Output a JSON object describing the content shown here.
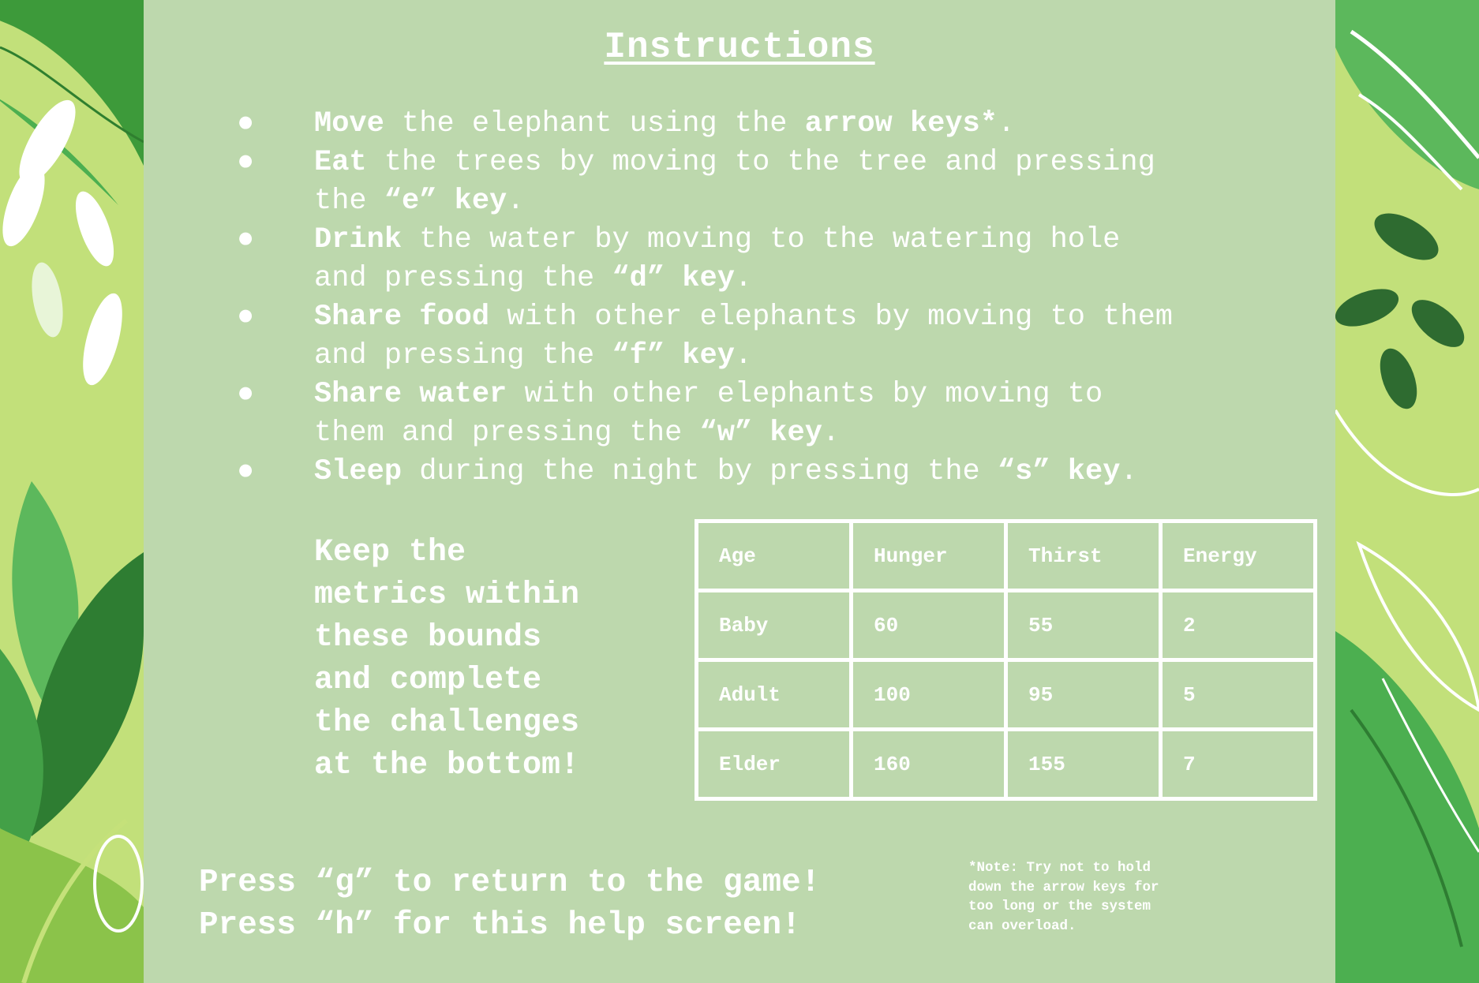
{
  "colors": {
    "panel": "#bdd8ad",
    "text": "#ffffff",
    "jungle_bg": "#c2e07a"
  },
  "title": "Instructions",
  "instructions": [
    {
      "bold": "Move",
      "rest": " the elephant using the ",
      "bold2": "arrow keys*",
      "tail": "."
    },
    {
      "bold": "Eat",
      "rest": " the trees by moving to the tree and pressing\nthe ",
      "bold2": "“e” key",
      "tail": "."
    },
    {
      "bold": "Drink",
      "rest": " the water by moving to the watering hole\nand pressing the ",
      "bold2": "“d” key",
      "tail": "."
    },
    {
      "bold": "Share food",
      "rest": " with other elephants by moving to them\nand pressing the ",
      "bold2": "“f” key",
      "tail": "."
    },
    {
      "bold": "Share water",
      "rest": " with other elephants by moving to\nthem and pressing the ",
      "bold2": "“w” key",
      "tail": "."
    },
    {
      "bold": "Sleep",
      "rest": " during the night by pressing the ",
      "bold2": "“s” key",
      "tail": "."
    }
  ],
  "bullet_glyph": "●",
  "keep_text": "Keep the\nmetrics within\nthese bounds\nand complete\nthe challenges\nat the bottom!",
  "metrics_table": {
    "headers": [
      "Age",
      "Hunger",
      "Thirst",
      "Energy"
    ],
    "rows": [
      [
        "Baby",
        "60",
        "55",
        "2"
      ],
      [
        "Adult",
        "100",
        "95",
        "5"
      ],
      [
        "Elder",
        "160",
        "155",
        "7"
      ]
    ]
  },
  "press_text": "Press “g” to return to the game!\nPress “h” for this help screen!",
  "note_text": "*Note: Try not to hold\ndown the arrow keys for\ntoo long or the system\ncan overload."
}
